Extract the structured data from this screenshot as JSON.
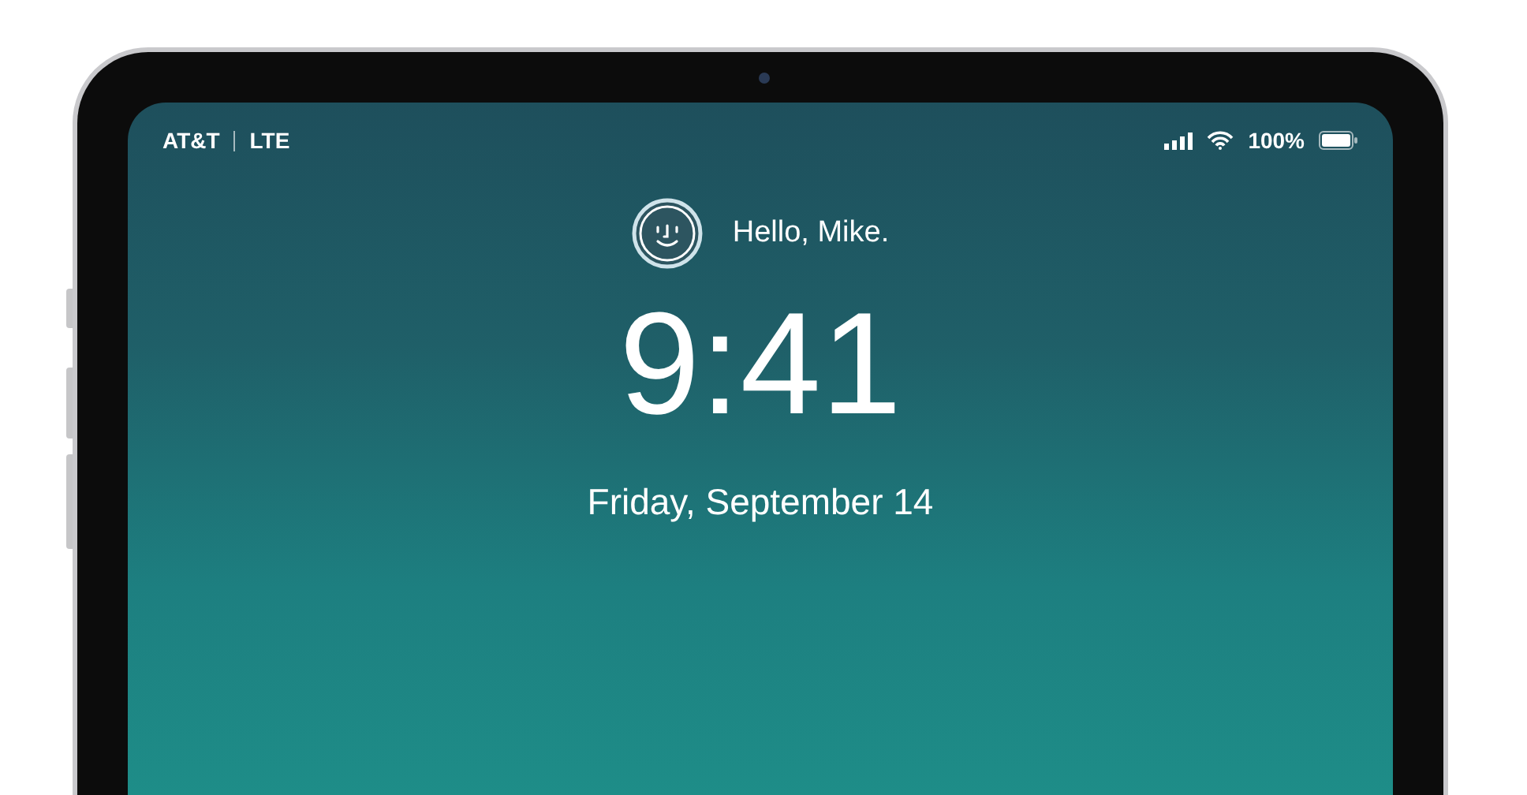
{
  "status_bar": {
    "carrier": "AT&T",
    "network": "LTE",
    "battery": "100%"
  },
  "lock_screen": {
    "greeting": "Hello, Mike.",
    "time": "9:41",
    "date": "Friday, September 14"
  }
}
